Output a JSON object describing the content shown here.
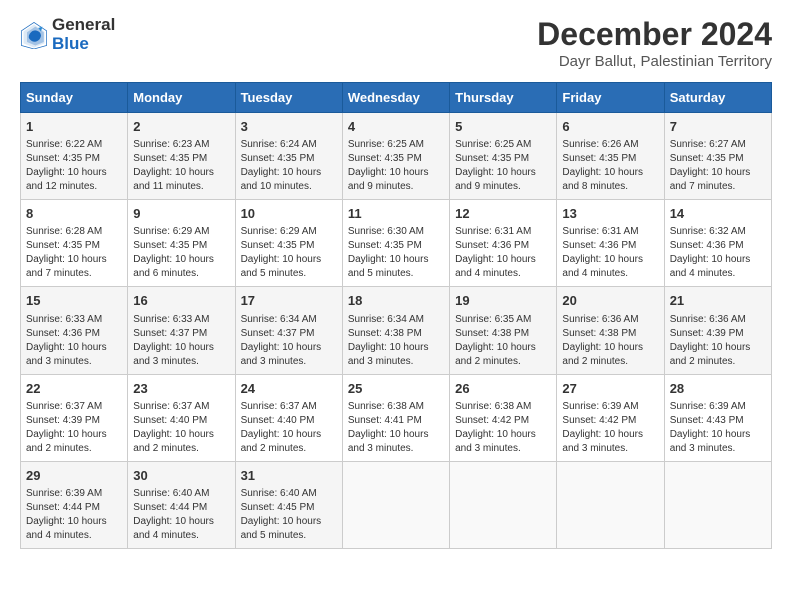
{
  "header": {
    "logo_general": "General",
    "logo_blue": "Blue",
    "main_title": "December 2024",
    "subtitle": "Dayr Ballut, Palestinian Territory"
  },
  "calendar": {
    "days_of_week": [
      "Sunday",
      "Monday",
      "Tuesday",
      "Wednesday",
      "Thursday",
      "Friday",
      "Saturday"
    ],
    "weeks": [
      [
        {
          "day": 1,
          "sunrise": "6:22 AM",
          "sunset": "4:35 PM",
          "daylight": "10 hours and 12 minutes."
        },
        {
          "day": 2,
          "sunrise": "6:23 AM",
          "sunset": "4:35 PM",
          "daylight": "10 hours and 11 minutes."
        },
        {
          "day": 3,
          "sunrise": "6:24 AM",
          "sunset": "4:35 PM",
          "daylight": "10 hours and 10 minutes."
        },
        {
          "day": 4,
          "sunrise": "6:25 AM",
          "sunset": "4:35 PM",
          "daylight": "10 hours and 9 minutes."
        },
        {
          "day": 5,
          "sunrise": "6:25 AM",
          "sunset": "4:35 PM",
          "daylight": "10 hours and 9 minutes."
        },
        {
          "day": 6,
          "sunrise": "6:26 AM",
          "sunset": "4:35 PM",
          "daylight": "10 hours and 8 minutes."
        },
        {
          "day": 7,
          "sunrise": "6:27 AM",
          "sunset": "4:35 PM",
          "daylight": "10 hours and 7 minutes."
        }
      ],
      [
        {
          "day": 8,
          "sunrise": "6:28 AM",
          "sunset": "4:35 PM",
          "daylight": "10 hours and 7 minutes."
        },
        {
          "day": 9,
          "sunrise": "6:29 AM",
          "sunset": "4:35 PM",
          "daylight": "10 hours and 6 minutes."
        },
        {
          "day": 10,
          "sunrise": "6:29 AM",
          "sunset": "4:35 PM",
          "daylight": "10 hours and 5 minutes."
        },
        {
          "day": 11,
          "sunrise": "6:30 AM",
          "sunset": "4:35 PM",
          "daylight": "10 hours and 5 minutes."
        },
        {
          "day": 12,
          "sunrise": "6:31 AM",
          "sunset": "4:36 PM",
          "daylight": "10 hours and 4 minutes."
        },
        {
          "day": 13,
          "sunrise": "6:31 AM",
          "sunset": "4:36 PM",
          "daylight": "10 hours and 4 minutes."
        },
        {
          "day": 14,
          "sunrise": "6:32 AM",
          "sunset": "4:36 PM",
          "daylight": "10 hours and 4 minutes."
        }
      ],
      [
        {
          "day": 15,
          "sunrise": "6:33 AM",
          "sunset": "4:36 PM",
          "daylight": "10 hours and 3 minutes."
        },
        {
          "day": 16,
          "sunrise": "6:33 AM",
          "sunset": "4:37 PM",
          "daylight": "10 hours and 3 minutes."
        },
        {
          "day": 17,
          "sunrise": "6:34 AM",
          "sunset": "4:37 PM",
          "daylight": "10 hours and 3 minutes."
        },
        {
          "day": 18,
          "sunrise": "6:34 AM",
          "sunset": "4:38 PM",
          "daylight": "10 hours and 3 minutes."
        },
        {
          "day": 19,
          "sunrise": "6:35 AM",
          "sunset": "4:38 PM",
          "daylight": "10 hours and 2 minutes."
        },
        {
          "day": 20,
          "sunrise": "6:36 AM",
          "sunset": "4:38 PM",
          "daylight": "10 hours and 2 minutes."
        },
        {
          "day": 21,
          "sunrise": "6:36 AM",
          "sunset": "4:39 PM",
          "daylight": "10 hours and 2 minutes."
        }
      ],
      [
        {
          "day": 22,
          "sunrise": "6:37 AM",
          "sunset": "4:39 PM",
          "daylight": "10 hours and 2 minutes."
        },
        {
          "day": 23,
          "sunrise": "6:37 AM",
          "sunset": "4:40 PM",
          "daylight": "10 hours and 2 minutes."
        },
        {
          "day": 24,
          "sunrise": "6:37 AM",
          "sunset": "4:40 PM",
          "daylight": "10 hours and 2 minutes."
        },
        {
          "day": 25,
          "sunrise": "6:38 AM",
          "sunset": "4:41 PM",
          "daylight": "10 hours and 3 minutes."
        },
        {
          "day": 26,
          "sunrise": "6:38 AM",
          "sunset": "4:42 PM",
          "daylight": "10 hours and 3 minutes."
        },
        {
          "day": 27,
          "sunrise": "6:39 AM",
          "sunset": "4:42 PM",
          "daylight": "10 hours and 3 minutes."
        },
        {
          "day": 28,
          "sunrise": "6:39 AM",
          "sunset": "4:43 PM",
          "daylight": "10 hours and 3 minutes."
        }
      ],
      [
        {
          "day": 29,
          "sunrise": "6:39 AM",
          "sunset": "4:44 PM",
          "daylight": "10 hours and 4 minutes."
        },
        {
          "day": 30,
          "sunrise": "6:40 AM",
          "sunset": "4:44 PM",
          "daylight": "10 hours and 4 minutes."
        },
        {
          "day": 31,
          "sunrise": "6:40 AM",
          "sunset": "4:45 PM",
          "daylight": "10 hours and 5 minutes."
        },
        null,
        null,
        null,
        null
      ]
    ]
  }
}
